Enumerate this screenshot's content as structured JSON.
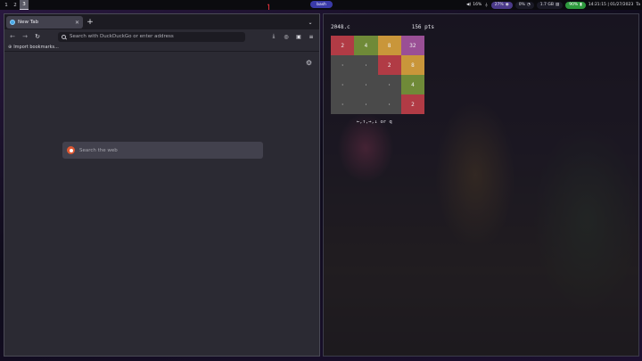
{
  "topbar": {
    "workspaces": [
      "1",
      "2",
      "3"
    ],
    "active_workspace": "3",
    "window_label": "bash",
    "status": {
      "volume": "16%",
      "mic_icon": "mic-off-icon",
      "cpu": "27%",
      "cpu_icon": "cpu-icon",
      "disk": "0%",
      "disk_icon": "disk-icon",
      "memory": "1.7 GB",
      "memory_icon": "memory-icon",
      "battery": "90%",
      "battery_icon": "battery-icon",
      "datetime": "14:21:15 | 01/27/2023",
      "layout_indicator": "Ta"
    }
  },
  "browser": {
    "tab_title": "New Tab",
    "urlbar_placeholder": "Search with DuckDuckGo or enter address",
    "bookmark_label": "Import bookmarks...",
    "websearch_placeholder": "Search the web"
  },
  "terminal": {
    "game_title": "2048.c",
    "score": "156 pts",
    "board": [
      [
        {
          "v": "2",
          "c": "#b13b45"
        },
        {
          "v": "4",
          "c": "#6f8a38"
        },
        {
          "v": "8",
          "c": "#c9963a"
        },
        {
          "v": "32",
          "c": "#9a4f95"
        }
      ],
      [
        {
          "v": "·",
          "c": "#4a4a4a"
        },
        {
          "v": "·",
          "c": "#4a4a4a"
        },
        {
          "v": "2",
          "c": "#b13b45"
        },
        {
          "v": "8",
          "c": "#c9963a"
        }
      ],
      [
        {
          "v": "·",
          "c": "#4a4a4a"
        },
        {
          "v": "·",
          "c": "#4a4a4a"
        },
        {
          "v": "·",
          "c": "#4a4a4a"
        },
        {
          "v": "4",
          "c": "#6f8a38"
        }
      ],
      [
        {
          "v": "·",
          "c": "#4a4a4a"
        },
        {
          "v": "·",
          "c": "#4a4a4a"
        },
        {
          "v": "·",
          "c": "#4a4a4a"
        },
        {
          "v": "2",
          "c": "#b13b45"
        }
      ]
    ],
    "controls_hint": "←,↑,→,↓ or q"
  },
  "colors": {
    "accent_pill": "#3a3aa8",
    "battery_pill": "#2e9a3e",
    "browser_bg": "#2b2a33"
  }
}
